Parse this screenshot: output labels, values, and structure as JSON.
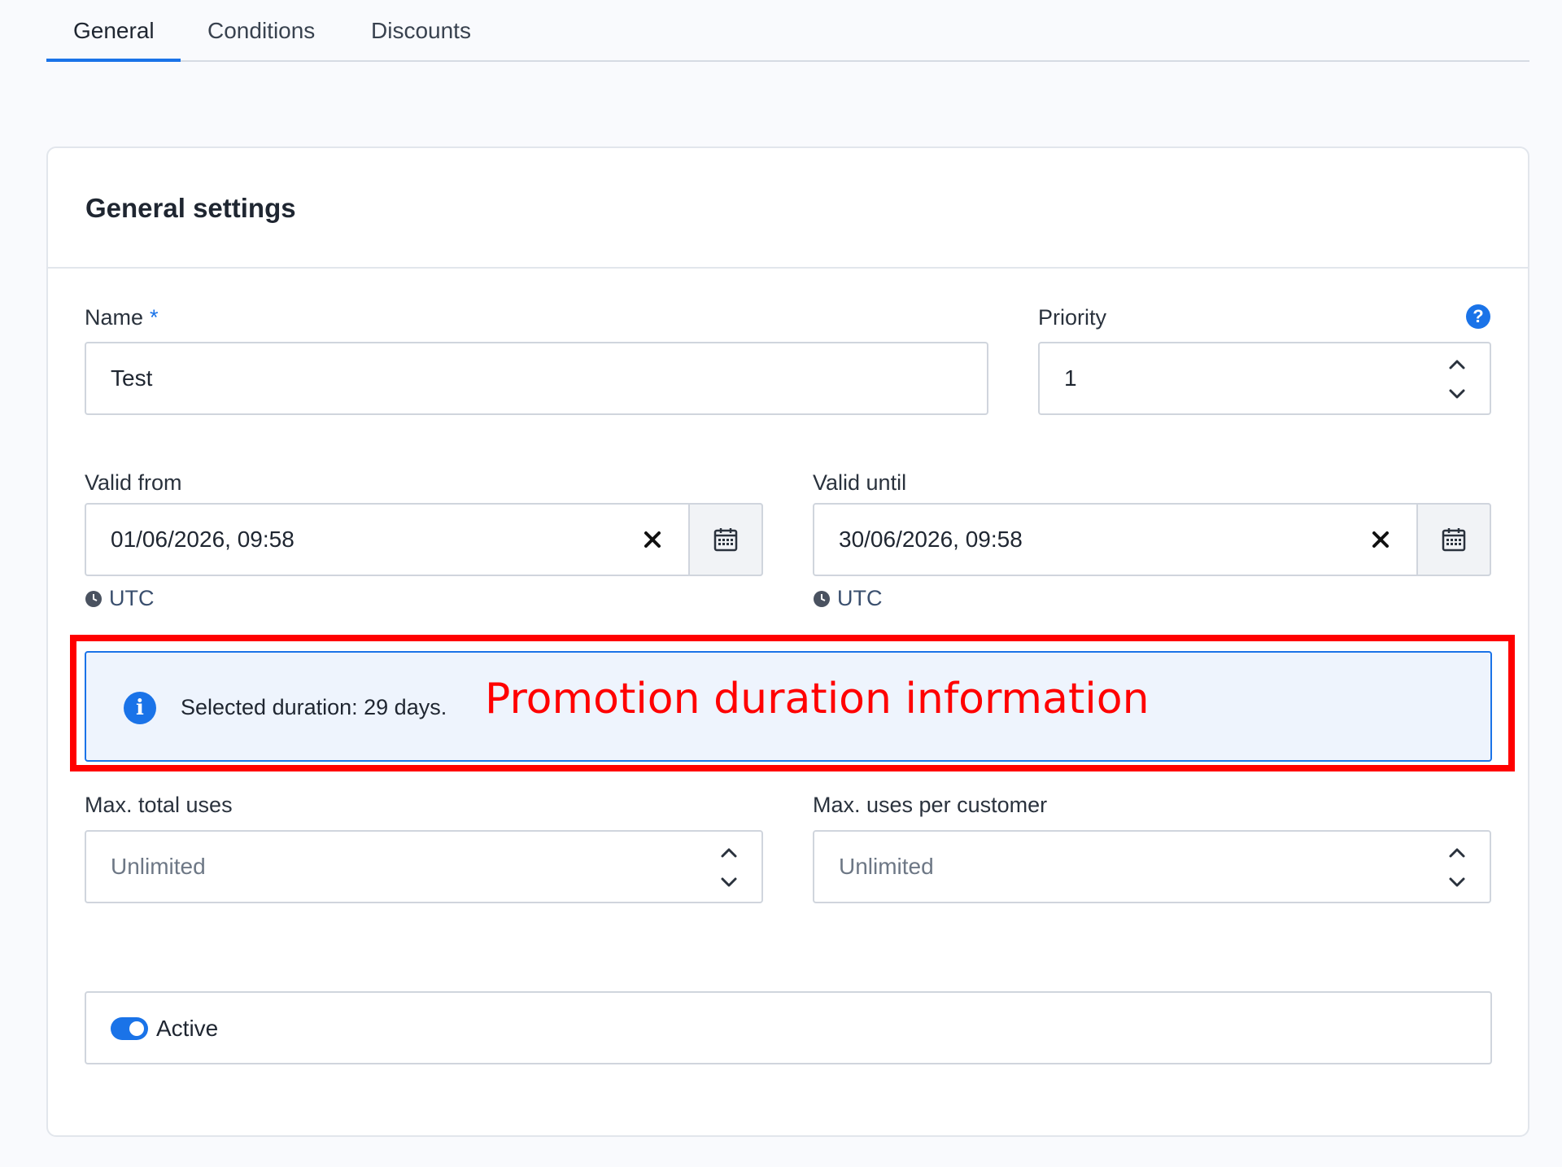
{
  "tabs": [
    {
      "label": "General",
      "active": true
    },
    {
      "label": "Conditions",
      "active": false
    },
    {
      "label": "Discounts",
      "active": false
    }
  ],
  "card": {
    "title": "General settings"
  },
  "form": {
    "name": {
      "label": "Name",
      "required_mark": "*",
      "value": "Test"
    },
    "priority": {
      "label": "Priority",
      "value": "1",
      "help_icon": "?"
    },
    "valid_from": {
      "label": "Valid from",
      "value": "01/06/2026, 09:58",
      "timezone": "UTC"
    },
    "valid_until": {
      "label": "Valid until",
      "value": "30/06/2026, 09:58",
      "timezone": "UTC"
    },
    "duration_alert": {
      "text": "Selected duration: 29 days.",
      "icon": "i"
    },
    "max_total_uses": {
      "label": "Max. total uses",
      "placeholder": "Unlimited"
    },
    "max_uses_per_customer": {
      "label": "Max. uses per customer",
      "placeholder": "Unlimited"
    },
    "active": {
      "label": "Active",
      "checked": true
    }
  },
  "annotation": {
    "text": "Promotion duration information",
    "color": "#ff0000"
  },
  "colors": {
    "accent": "#1a73e8",
    "alert_bg": "#eef4fd"
  }
}
